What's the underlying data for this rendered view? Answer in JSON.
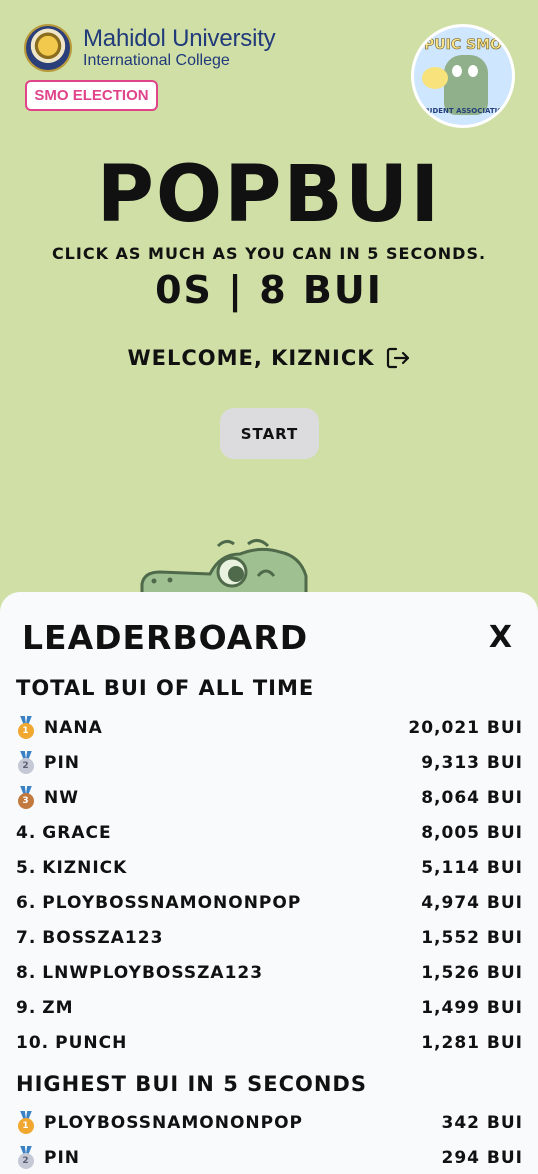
{
  "header": {
    "university_name": "Mahidol University",
    "college_name": "International College",
    "badge_label": "SMO ELECTION",
    "club_logo_title": "PUIC SMO",
    "club_logo_subtitle": "STUDENT ASSOCIATION"
  },
  "game": {
    "title": "POPBUI",
    "instructions": "CLICK AS MUCH AS YOU CAN IN 5 SECONDS.",
    "score_display": "0S | 8 BUI",
    "welcome_text": "WELCOME, KIZNICK",
    "start_label": "START"
  },
  "leaderboard": {
    "title": "LEADERBOARD",
    "close_label": "X",
    "all_time": {
      "heading": "TOTAL BUI OF ALL TIME",
      "rows": [
        {
          "rank": "🥇",
          "medal": "gold",
          "name": "NANA",
          "score": "20,021 BUI"
        },
        {
          "rank": "🥈",
          "medal": "silver",
          "name": "PIN",
          "score": "9,313 BUI"
        },
        {
          "rank": "🥉",
          "medal": "bronze",
          "name": "NW",
          "score": "8,064 BUI"
        },
        {
          "rank": "4.",
          "name": "GRACE",
          "score": "8,005 BUI"
        },
        {
          "rank": "5.",
          "name": "KIZNICK",
          "score": "5,114 BUI"
        },
        {
          "rank": "6.",
          "name": "PLOYBOSSNAMONONPOP",
          "score": "4,974 BUI"
        },
        {
          "rank": "7.",
          "name": "BOSSZA123",
          "score": "1,552 BUI"
        },
        {
          "rank": "8.",
          "name": "LNWPLOYBOSSZA123",
          "score": "1,526 BUI"
        },
        {
          "rank": "9.",
          "name": "ZM",
          "score": "1,499 BUI"
        },
        {
          "rank": "10.",
          "name": "PUNCH",
          "score": "1,281 BUI"
        }
      ]
    },
    "five_seconds": {
      "heading": "HIGHEST BUI IN 5 SECONDS",
      "rows": [
        {
          "rank": "🥇",
          "medal": "gold",
          "name": "PLOYBOSSNAMONONPOP",
          "score": "342 BUI"
        },
        {
          "rank": "🥈",
          "medal": "silver",
          "name": "PIN",
          "score": "294 BUI"
        }
      ]
    }
  },
  "colors": {
    "background": "#d0dfa6",
    "panel": "#f8fafc",
    "badge_accent": "#e0448a",
    "university_blue": "#203a7a"
  }
}
